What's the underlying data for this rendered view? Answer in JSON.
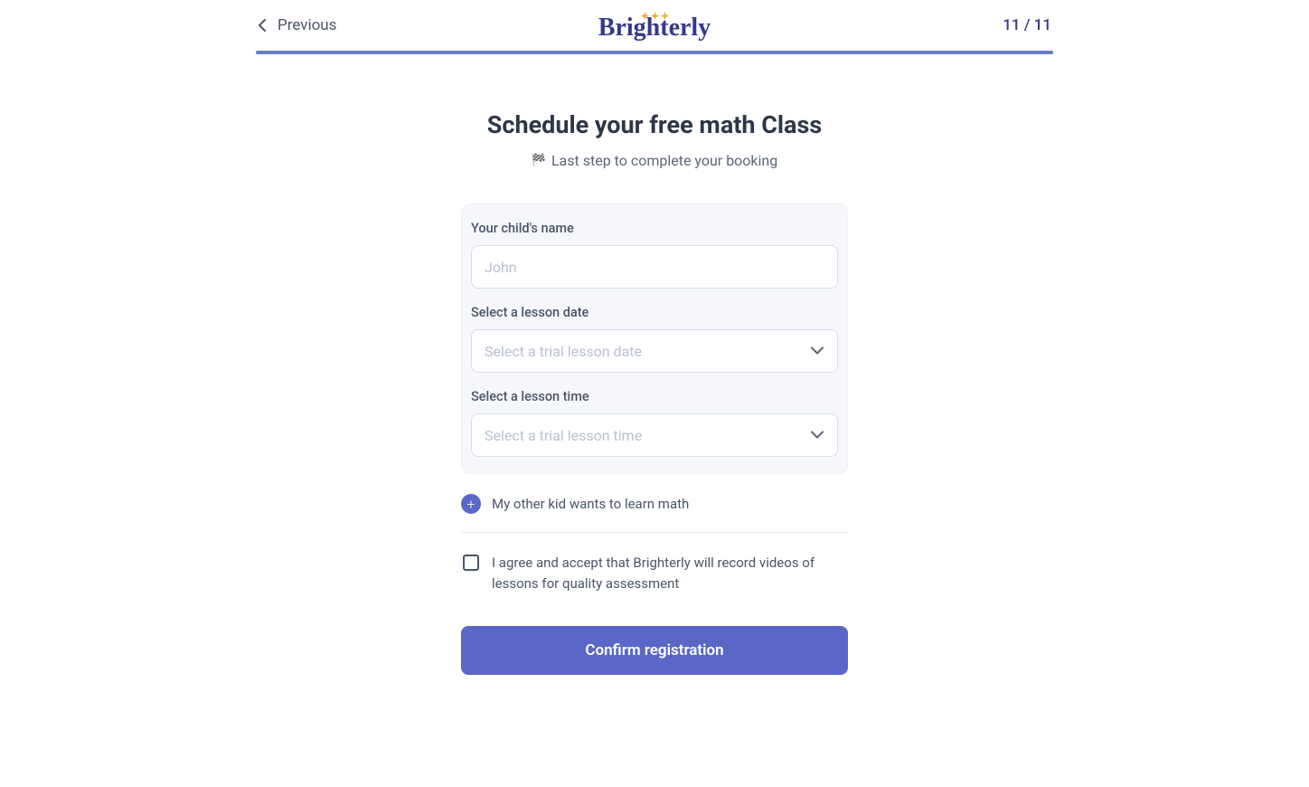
{
  "header": {
    "previous_label": "Previous",
    "step_counter": "11 / 11",
    "logo_text": "Brighterly"
  },
  "main": {
    "title": "Schedule your free math Class",
    "subtitle": "Last step to complete your booking",
    "form": {
      "child_name": {
        "label": "Your child's name",
        "placeholder": "John",
        "value": ""
      },
      "lesson_date": {
        "label": "Select a lesson date",
        "placeholder": "Select a trial lesson date",
        "value": ""
      },
      "lesson_time": {
        "label": "Select a lesson time",
        "placeholder": "Select a trial lesson time",
        "value": ""
      }
    },
    "add_kid_text": "My other kid wants to learn math",
    "consent_text": "I agree and accept that Brighterly will record videos of lessons for quality assessment",
    "confirm_button": "Confirm registration"
  }
}
